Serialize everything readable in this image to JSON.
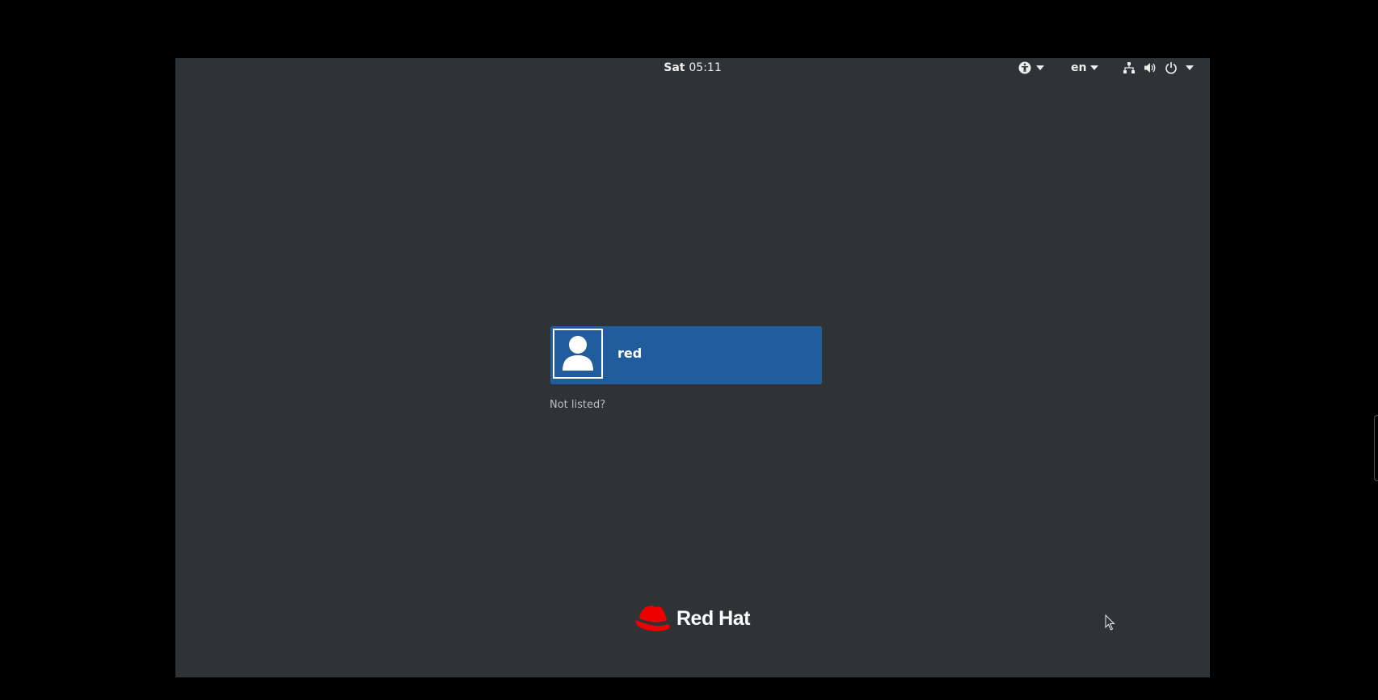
{
  "topbar": {
    "clock_day": "Sat",
    "clock_time": "05:11",
    "language": "en",
    "icons": [
      "accessibility-icon",
      "network-icon",
      "volume-icon",
      "power-icon"
    ]
  },
  "user_list": {
    "users": [
      {
        "name": "red"
      }
    ],
    "not_listed_label": "Not listed?"
  },
  "logo": {
    "text": "Red Hat",
    "color": "#ee0000"
  },
  "colors": {
    "background": "#2f3336",
    "selected_user": "#215d9c",
    "outer": "#000000"
  }
}
